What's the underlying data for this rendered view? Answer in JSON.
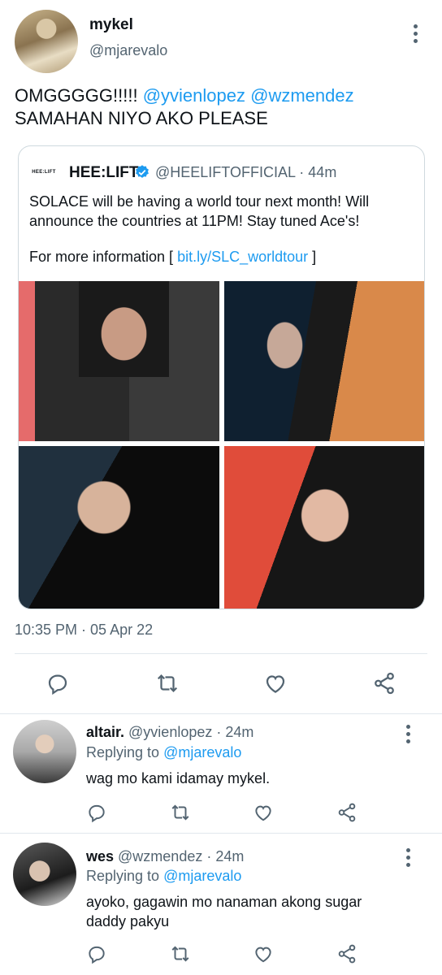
{
  "main_tweet": {
    "display_name": "mykel",
    "handle": "@mjarevalo",
    "text_start": "OMGGGGG!!!!! ",
    "mention_1": "@yvienlopez",
    "mention_2": "@wzmendez",
    "text_line2": "SAMAHAN NIYO AKO PLEASE",
    "timestamp": "10:35 PM · 05 Apr 22"
  },
  "quoted_tweet": {
    "logo_text": "HEE:LIFT",
    "display_name": "HEE:LIFT",
    "handle_time": "@HEELIFTOFFICIAL · 44m",
    "text": "SOLACE will be having a world tour next month! Will announce the countries at 11PM! Stay tuned Ace's!",
    "info_prefix": "For more information [ ",
    "link": "bit.ly/SLC_worldtour",
    "info_suffix": " ]"
  },
  "replies": [
    {
      "display_name": "altair.",
      "handle_time": " @yvienlopez · 24m",
      "replying_prefix": "Replying to ",
      "replying_to": "@mjarevalo",
      "text": "wag mo kami idamay mykel."
    },
    {
      "display_name": "wes",
      "handle_time": " @wzmendez · 24m",
      "replying_prefix": "Replying to ",
      "replying_to": "@mjarevalo",
      "text": "ayoko, gagawin mo nanaman akong sugar daddy pakyu"
    }
  ],
  "icons": [
    "reply-icon",
    "retweet-icon",
    "like-icon",
    "share-icon",
    "more-icon",
    "verified-icon"
  ],
  "colors": {
    "accent": "#1d9bf0",
    "secondary_text": "#536471",
    "primary_text": "#0f1419"
  }
}
